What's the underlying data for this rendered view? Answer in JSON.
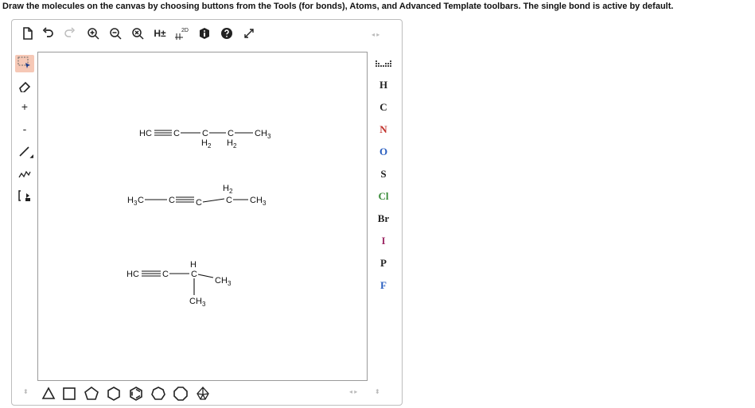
{
  "instructions": "Draw the molecules on the canvas by choosing buttons from the Tools (for bonds), Atoms, and Advanced Template toolbars. The single bond is active by default.",
  "top_toolbar": {
    "clean2d_label": "2D",
    "hydrogens_label": "H±"
  },
  "left_toolbar": {
    "plus_label": "+",
    "minus_label": "-"
  },
  "atoms": [
    "H",
    "C",
    "N",
    "O",
    "S",
    "Cl",
    "Br",
    "I",
    "P",
    "F"
  ],
  "atom_colors": {
    "H": "#222222",
    "C": "#222222",
    "N": "#c0302a",
    "O": "#2a5fc0",
    "S": "#222222",
    "Cl": "#3a8c3a",
    "Br": "#222222",
    "I": "#a0306a",
    "P": "#222222",
    "F": "#2a5fc0"
  },
  "molecules": {
    "m1": {
      "hc": "HC",
      "c": "C",
      "c2": "C",
      "h2a": "H",
      "h2a_sub": "2",
      "c3": "C",
      "h2b": "H",
      "h2b_sub": "2",
      "ch": "CH",
      "ch_sub": "3"
    },
    "m2": {
      "h3c": "H",
      "h3c_sub": "3",
      "h3c_c": "C",
      "c1": "C",
      "c2": "C",
      "h2": "H",
      "h2_sub": "2",
      "c3": "C",
      "ch": "CH",
      "ch_sub": "3"
    },
    "m3": {
      "hc": "HC",
      "c": "C",
      "h": "H",
      "c2": "C",
      "ch": "CH",
      "ch_sub": "3",
      "ch2": "CH",
      "ch2_sub": "3"
    }
  }
}
